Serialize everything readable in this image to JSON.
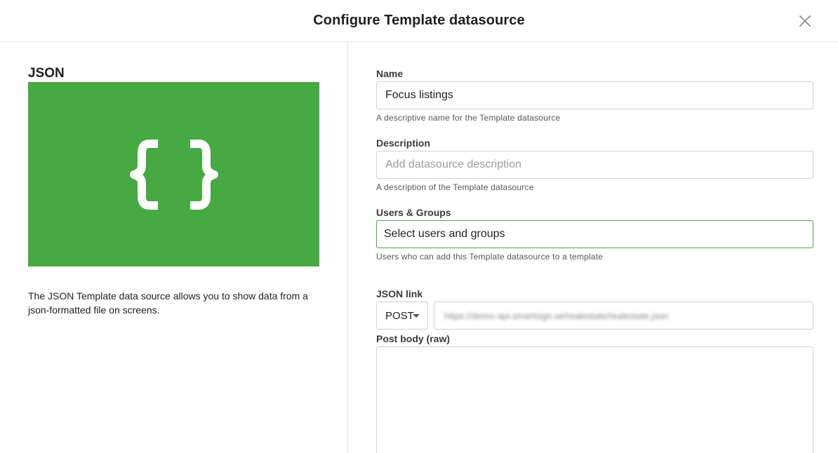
{
  "header": {
    "title": "Configure Template datasource",
    "close_icon": "close-icon"
  },
  "left": {
    "heading": "JSON",
    "banner_icon": "curly-braces-icon",
    "banner_color": "#46a941",
    "description": "The JSON Template data source allows you to show data from a json-formatted file on screens."
  },
  "form": {
    "name": {
      "label": "Name",
      "value": "Focus listings",
      "helper": "A descriptive name for the Template datasource"
    },
    "description": {
      "label": "Description",
      "value": "",
      "placeholder": "Add datasource description",
      "helper": "A description of the Template datasource"
    },
    "users_groups": {
      "label": "Users & Groups",
      "value": "Select users and groups",
      "helper": "Users who can add this Template datasource to a template"
    },
    "json_link": {
      "label": "JSON link",
      "method": "POST",
      "url": "https://demo-api.smartsign.se/realestate/realestate.json"
    },
    "post_body": {
      "label": "Post body (raw)",
      "value": ""
    }
  },
  "colors": {
    "accent_green": "#46a941"
  }
}
